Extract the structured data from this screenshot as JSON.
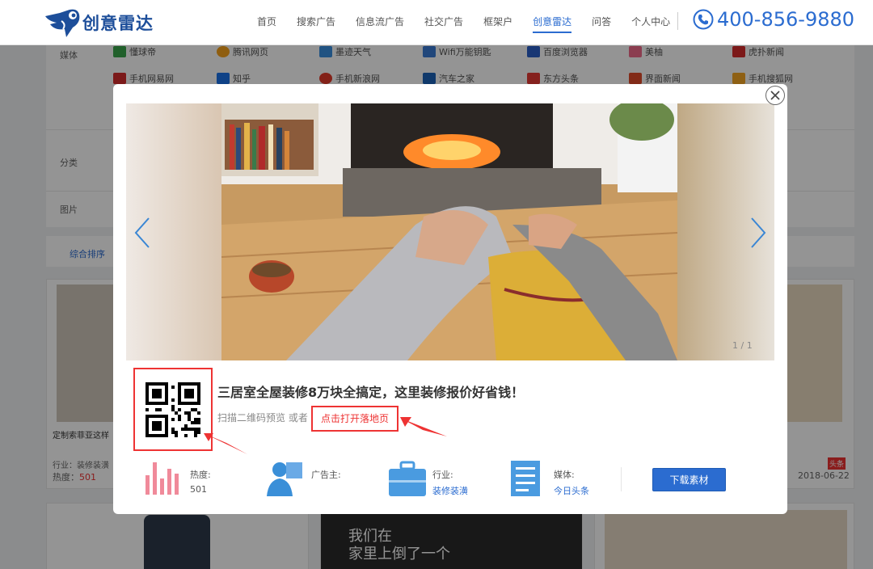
{
  "header": {
    "logo_text": "创意雷达",
    "nav": [
      "首页",
      "搜索广告",
      "信息流广告",
      "社交广告",
      "框架户",
      "创意雷达",
      "问答",
      "个人中心"
    ],
    "active_nav": "创意雷达",
    "phone": "400-856-9880"
  },
  "filters": {
    "media_label": "媒体",
    "media_row1": [
      "懂球帝",
      "腾讯网页",
      "墨迹天气",
      "Wifi万能钥匙",
      "百度浏览器",
      "美柚",
      "虎扑新闻"
    ],
    "media_row2": [
      "手机网易网",
      "知乎",
      "手机新浪网",
      "汽车之家",
      "东方头条",
      "界面新闻",
      "手机搜狐网"
    ],
    "category_label": "分类",
    "image_label": "图片",
    "sort_label": "综合排序"
  },
  "background_cards": {
    "left_title": "定制索菲亚这样",
    "left_industry": "行业：装修装潢",
    "left_heat_label": "热度：",
    "left_heat_value": "501",
    "right_date": "2018-06-22",
    "right_badge": "头条",
    "bottom_text_1": "我们在",
    "bottom_text_2": "家里上倒了一个"
  },
  "modal": {
    "counter": "1 / 1",
    "title": "三居室全屋装修8万块全搞定，这里装修报价好省钱！",
    "scan_text": "扫描二维码预览 或者",
    "open_link": "点击打开落地页",
    "heat_label": "热度:",
    "heat_value": "501",
    "advertiser_label": "广告主:",
    "advertiser_value": "",
    "industry_label": "行业:",
    "industry_value": "装修装潢",
    "media_label": "媒体:",
    "media_value": "今日头条",
    "download_button": "下载素材",
    "colors": {
      "accent": "#2b6cd0",
      "highlight": "#e33333"
    }
  }
}
